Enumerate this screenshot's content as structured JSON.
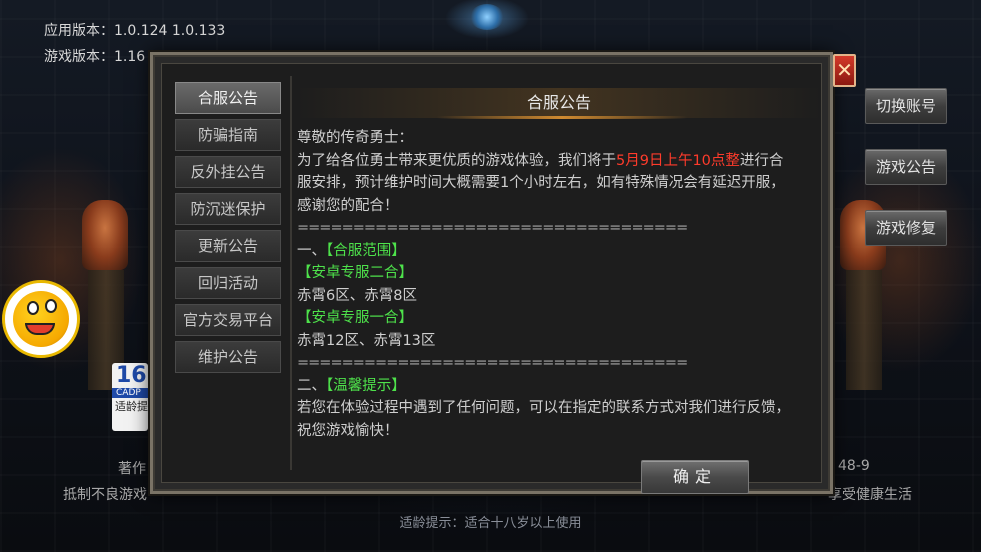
{
  "version": {
    "app_label": "应用版本：1.0.124 1.0.133",
    "game_label": "游戏版本：1.16"
  },
  "age_badge": {
    "num": "16",
    "cad": "CADP",
    "text": "适龄提"
  },
  "right_buttons": [
    "切换账号",
    "游戏公告",
    "游戏修复"
  ],
  "bottom": {
    "left_partial_1": "著作",
    "left_partial_2": "抵制不良游戏",
    "right_partial_1": "48-9",
    "right_partial_2": "享受健康生活",
    "tip": "适龄提示：适合十八岁以上使用"
  },
  "dialog": {
    "close_label": "✕",
    "tabs": [
      "合服公告",
      "防骗指南",
      "反外挂公告",
      "防沉迷保护",
      "更新公告",
      "回归活动",
      "官方交易平台",
      "维护公告"
    ],
    "active_tab": 0,
    "title": "合服公告",
    "greeting": "尊敬的传奇勇士：",
    "line1_a": "为了给各位勇士带来更优质的游戏体验，我们将于",
    "line1_red": "5月9日上午10点整",
    "line1_b": "进行合",
    "line2": "服安排，预计维护时间大概需要1个小时左右，如有特殊情况会有延迟开服，",
    "line3": "感谢您的配合！",
    "divider": "===================================",
    "section1_prefix": "一、",
    "section1_title": "【合服范围】",
    "group1_title": "【安卓专服二合】",
    "group1_servers": "赤霄6区、赤霄8区",
    "group2_title": "【安卓专服一合】",
    "group2_servers": "赤霄12区、赤霄13区",
    "section2_prefix": "二、",
    "section2_title": "【温馨提示】",
    "tip_line1": "若您在体验过程中遇到了任何问题，可以在指定的联系方式对我们进行反馈，",
    "tip_line2": "祝您游戏愉快！",
    "confirm_label": "确定"
  }
}
